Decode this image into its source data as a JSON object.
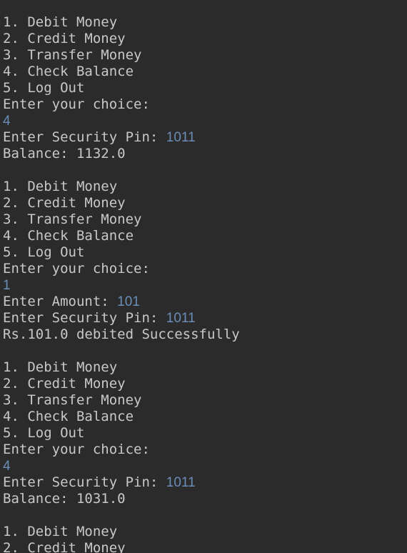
{
  "colors": {
    "background": "#2b2b2b",
    "output_text": "#c8c8c8",
    "user_input": "#6b8db8"
  },
  "console": {
    "lines": [
      {
        "text": "1. Debit Money"
      },
      {
        "text": "2. Credit Money"
      },
      {
        "text": "3. Transfer Money"
      },
      {
        "text": "4. Check Balance"
      },
      {
        "text": "5. Log Out"
      },
      {
        "text": "Enter your choice:"
      },
      {
        "text": "",
        "input": "4"
      },
      {
        "text": "Enter Security Pin: ",
        "input": "1011"
      },
      {
        "text": "Balance: 1132.0"
      },
      {
        "text": ""
      },
      {
        "text": "1. Debit Money"
      },
      {
        "text": "2. Credit Money"
      },
      {
        "text": "3. Transfer Money"
      },
      {
        "text": "4. Check Balance"
      },
      {
        "text": "5. Log Out"
      },
      {
        "text": "Enter your choice:"
      },
      {
        "text": "",
        "input": "1"
      },
      {
        "text": "Enter Amount: ",
        "input": "101"
      },
      {
        "text": "Enter Security Pin: ",
        "input": "1011"
      },
      {
        "text": "Rs.101.0 debited Successfully"
      },
      {
        "text": ""
      },
      {
        "text": "1. Debit Money"
      },
      {
        "text": "2. Credit Money"
      },
      {
        "text": "3. Transfer Money"
      },
      {
        "text": "4. Check Balance"
      },
      {
        "text": "5. Log Out"
      },
      {
        "text": "Enter your choice:"
      },
      {
        "text": "",
        "input": "4"
      },
      {
        "text": "Enter Security Pin: ",
        "input": "1011"
      },
      {
        "text": "Balance: 1031.0"
      },
      {
        "text": ""
      },
      {
        "text": "1. Debit Money"
      },
      {
        "text": "2. Credit Money"
      }
    ]
  }
}
